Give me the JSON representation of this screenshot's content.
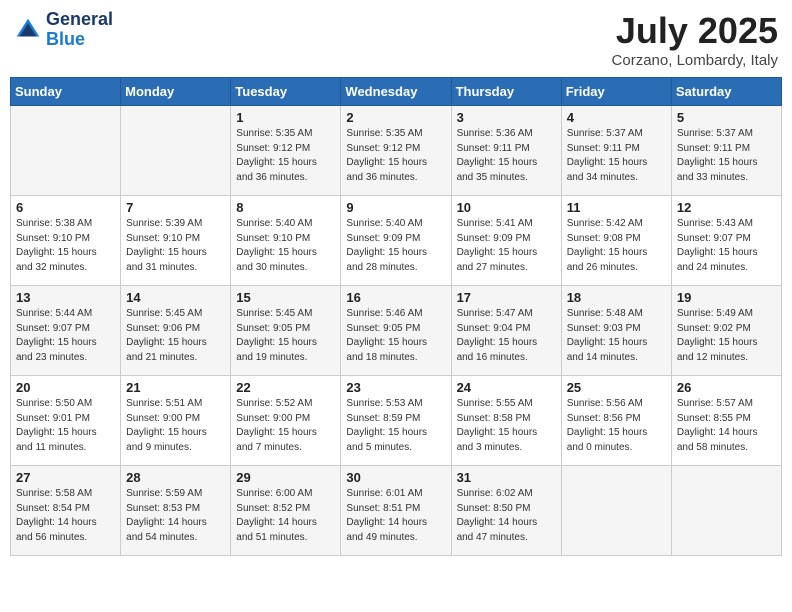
{
  "header": {
    "logo_line1": "General",
    "logo_line2": "Blue",
    "title": "July 2025",
    "subtitle": "Corzano, Lombardy, Italy"
  },
  "columns": [
    "Sunday",
    "Monday",
    "Tuesday",
    "Wednesday",
    "Thursday",
    "Friday",
    "Saturday"
  ],
  "weeks": [
    [
      {
        "day": "",
        "info": ""
      },
      {
        "day": "",
        "info": ""
      },
      {
        "day": "1",
        "info": "Sunrise: 5:35 AM\nSunset: 9:12 PM\nDaylight: 15 hours\nand 36 minutes."
      },
      {
        "day": "2",
        "info": "Sunrise: 5:35 AM\nSunset: 9:12 PM\nDaylight: 15 hours\nand 36 minutes."
      },
      {
        "day": "3",
        "info": "Sunrise: 5:36 AM\nSunset: 9:11 PM\nDaylight: 15 hours\nand 35 minutes."
      },
      {
        "day": "4",
        "info": "Sunrise: 5:37 AM\nSunset: 9:11 PM\nDaylight: 15 hours\nand 34 minutes."
      },
      {
        "day": "5",
        "info": "Sunrise: 5:37 AM\nSunset: 9:11 PM\nDaylight: 15 hours\nand 33 minutes."
      }
    ],
    [
      {
        "day": "6",
        "info": "Sunrise: 5:38 AM\nSunset: 9:10 PM\nDaylight: 15 hours\nand 32 minutes."
      },
      {
        "day": "7",
        "info": "Sunrise: 5:39 AM\nSunset: 9:10 PM\nDaylight: 15 hours\nand 31 minutes."
      },
      {
        "day": "8",
        "info": "Sunrise: 5:40 AM\nSunset: 9:10 PM\nDaylight: 15 hours\nand 30 minutes."
      },
      {
        "day": "9",
        "info": "Sunrise: 5:40 AM\nSunset: 9:09 PM\nDaylight: 15 hours\nand 28 minutes."
      },
      {
        "day": "10",
        "info": "Sunrise: 5:41 AM\nSunset: 9:09 PM\nDaylight: 15 hours\nand 27 minutes."
      },
      {
        "day": "11",
        "info": "Sunrise: 5:42 AM\nSunset: 9:08 PM\nDaylight: 15 hours\nand 26 minutes."
      },
      {
        "day": "12",
        "info": "Sunrise: 5:43 AM\nSunset: 9:07 PM\nDaylight: 15 hours\nand 24 minutes."
      }
    ],
    [
      {
        "day": "13",
        "info": "Sunrise: 5:44 AM\nSunset: 9:07 PM\nDaylight: 15 hours\nand 23 minutes."
      },
      {
        "day": "14",
        "info": "Sunrise: 5:45 AM\nSunset: 9:06 PM\nDaylight: 15 hours\nand 21 minutes."
      },
      {
        "day": "15",
        "info": "Sunrise: 5:45 AM\nSunset: 9:05 PM\nDaylight: 15 hours\nand 19 minutes."
      },
      {
        "day": "16",
        "info": "Sunrise: 5:46 AM\nSunset: 9:05 PM\nDaylight: 15 hours\nand 18 minutes."
      },
      {
        "day": "17",
        "info": "Sunrise: 5:47 AM\nSunset: 9:04 PM\nDaylight: 15 hours\nand 16 minutes."
      },
      {
        "day": "18",
        "info": "Sunrise: 5:48 AM\nSunset: 9:03 PM\nDaylight: 15 hours\nand 14 minutes."
      },
      {
        "day": "19",
        "info": "Sunrise: 5:49 AM\nSunset: 9:02 PM\nDaylight: 15 hours\nand 12 minutes."
      }
    ],
    [
      {
        "day": "20",
        "info": "Sunrise: 5:50 AM\nSunset: 9:01 PM\nDaylight: 15 hours\nand 11 minutes."
      },
      {
        "day": "21",
        "info": "Sunrise: 5:51 AM\nSunset: 9:00 PM\nDaylight: 15 hours\nand 9 minutes."
      },
      {
        "day": "22",
        "info": "Sunrise: 5:52 AM\nSunset: 9:00 PM\nDaylight: 15 hours\nand 7 minutes."
      },
      {
        "day": "23",
        "info": "Sunrise: 5:53 AM\nSunset: 8:59 PM\nDaylight: 15 hours\nand 5 minutes."
      },
      {
        "day": "24",
        "info": "Sunrise: 5:55 AM\nSunset: 8:58 PM\nDaylight: 15 hours\nand 3 minutes."
      },
      {
        "day": "25",
        "info": "Sunrise: 5:56 AM\nSunset: 8:56 PM\nDaylight: 15 hours\nand 0 minutes."
      },
      {
        "day": "26",
        "info": "Sunrise: 5:57 AM\nSunset: 8:55 PM\nDaylight: 14 hours\nand 58 minutes."
      }
    ],
    [
      {
        "day": "27",
        "info": "Sunrise: 5:58 AM\nSunset: 8:54 PM\nDaylight: 14 hours\nand 56 minutes."
      },
      {
        "day": "28",
        "info": "Sunrise: 5:59 AM\nSunset: 8:53 PM\nDaylight: 14 hours\nand 54 minutes."
      },
      {
        "day": "29",
        "info": "Sunrise: 6:00 AM\nSunset: 8:52 PM\nDaylight: 14 hours\nand 51 minutes."
      },
      {
        "day": "30",
        "info": "Sunrise: 6:01 AM\nSunset: 8:51 PM\nDaylight: 14 hours\nand 49 minutes."
      },
      {
        "day": "31",
        "info": "Sunrise: 6:02 AM\nSunset: 8:50 PM\nDaylight: 14 hours\nand 47 minutes."
      },
      {
        "day": "",
        "info": ""
      },
      {
        "day": "",
        "info": ""
      }
    ]
  ]
}
